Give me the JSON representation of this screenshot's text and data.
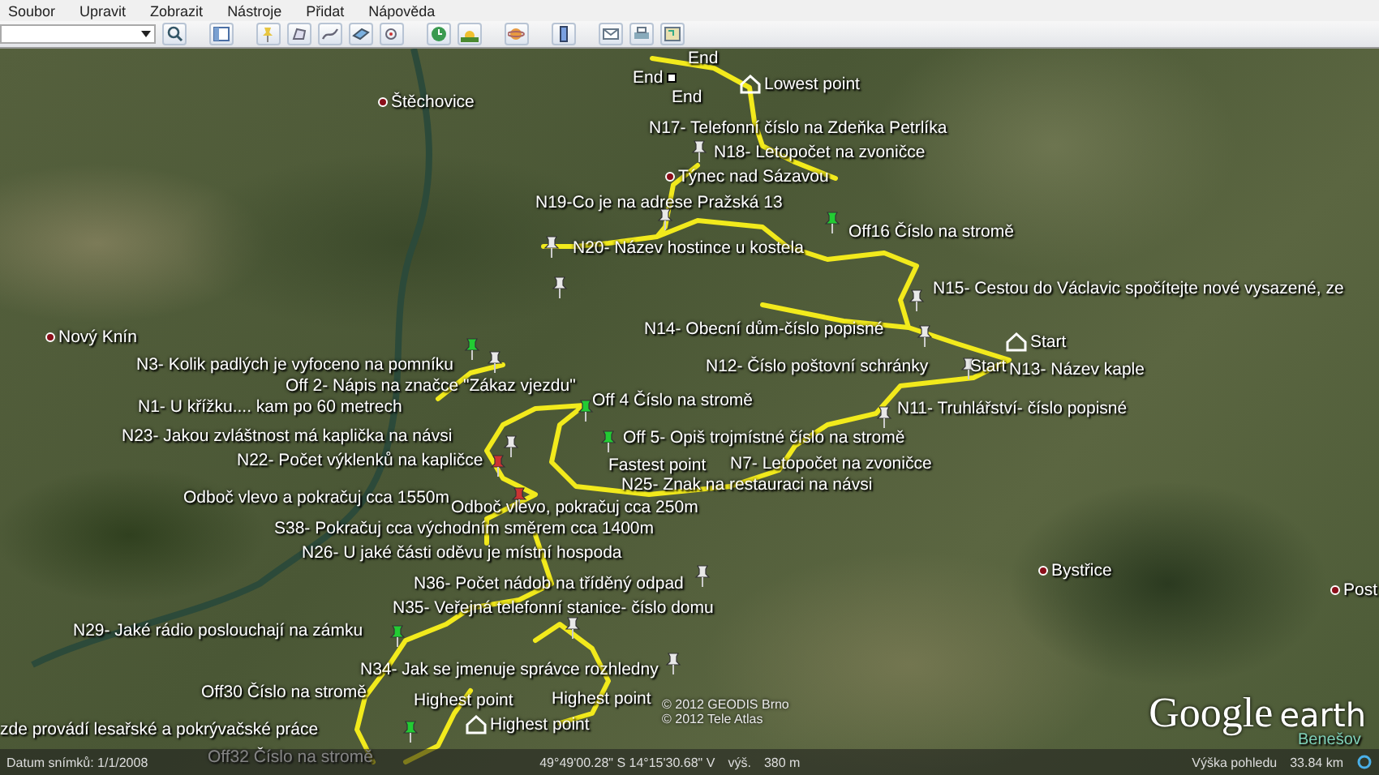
{
  "menu": [
    {
      "label": "Soubor"
    },
    {
      "label": "Upravit"
    },
    {
      "label": "Zobrazit"
    },
    {
      "label": "Nástroje"
    },
    {
      "label": "Přidat"
    },
    {
      "label": "Nápověda"
    }
  ],
  "map": {
    "labels": [
      {
        "kind": "square",
        "text": "End"
      },
      {
        "kind": "label",
        "text": "End"
      },
      {
        "kind": "label",
        "text": "End"
      },
      {
        "kind": "house",
        "text": "Lowest point"
      },
      {
        "kind": "town",
        "text": "Štěchovice"
      },
      {
        "kind": "label",
        "text": "N17- Telefonní číslo na Zdeňka Petrlíka"
      },
      {
        "kind": "label",
        "text": "N18- Letopočet na zvoničce"
      },
      {
        "kind": "town",
        "text": "Týnec nad Sázavou"
      },
      {
        "kind": "label",
        "text": "N19-Co je na adrese Pražská 13"
      },
      {
        "kind": "label",
        "text": "Off16 Číslo na stromě"
      },
      {
        "kind": "label",
        "text": "N20- Název hostince u kostela"
      },
      {
        "kind": "label",
        "text": "N15- Cestou do Václavic spočítejte nové vysazené, ze"
      },
      {
        "kind": "town",
        "text": "Nový Knín"
      },
      {
        "kind": "label",
        "text": "N14- Obecní dům-číslo popisné"
      },
      {
        "kind": "house",
        "text": "Start"
      },
      {
        "kind": "label",
        "text": "N3- Kolik padlých je vyfoceno na pomníku"
      },
      {
        "kind": "label",
        "text": "N12- Číslo poštovní schránky"
      },
      {
        "kind": "label",
        "text": "Start"
      },
      {
        "kind": "label",
        "text": "N13- Název kaple"
      },
      {
        "kind": "label",
        "text": "Off 2- Nápis na značce \"Zákaz vjezdu\""
      },
      {
        "kind": "label",
        "text": "Off 4 Číslo na stromě"
      },
      {
        "kind": "label",
        "text": "N1- U křížku.... kam po 60 metrech"
      },
      {
        "kind": "label",
        "text": "N11- Truhlářství- číslo popisné"
      },
      {
        "kind": "label",
        "text": "N23- Jakou zvláštnost má kaplička na návsi"
      },
      {
        "kind": "label",
        "text": "Off 5- Opiš trojmístné číslo na stromě"
      },
      {
        "kind": "label",
        "text": "N22- Počet výklenků na kapličce"
      },
      {
        "kind": "label",
        "text": "Fastest point"
      },
      {
        "kind": "label",
        "text": "N7- Letopočet na zvoničce"
      },
      {
        "kind": "label",
        "text": "N25- Znak na restauraci na návsi"
      },
      {
        "kind": "label",
        "text": "Odboč vlevo a pokračuj cca 1550m"
      },
      {
        "kind": "label",
        "text": "Odboč vlevo, pokračuj cca 250m"
      },
      {
        "kind": "label",
        "text": "S38- Pokračuj cca východním směrem cca 1400m"
      },
      {
        "kind": "label",
        "text": "N26- U jaké části oděvu je místní hospoda"
      },
      {
        "kind": "town",
        "text": "Bystřice"
      },
      {
        "kind": "label",
        "text": "N36- Počet nádob na tříděný odpad"
      },
      {
        "kind": "town",
        "text": "Post"
      },
      {
        "kind": "label",
        "text": "N35- Veřejná telefonní stanice- číslo domu"
      },
      {
        "kind": "label",
        "text": "N29- Jaké rádio poslouchají na zámku"
      },
      {
        "kind": "label",
        "text": "N34- Jak se jmenuje správce rozhledny"
      },
      {
        "kind": "label",
        "text": "Off30 Číslo na stromě"
      },
      {
        "kind": "label",
        "text": "Highest point"
      },
      {
        "kind": "label",
        "text": "Highest point"
      },
      {
        "kind": "house",
        "text": "Highest point"
      },
      {
        "kind": "label",
        "text": "zde provádí lesařské a pokrývačské práce"
      },
      {
        "kind": "label",
        "text": "Off32 Číslo na stromě"
      },
      {
        "kind": "region",
        "text": "Benešov"
      }
    ],
    "pins": [
      {
        "color": "#e8e8e8"
      },
      {
        "color": "#e8e8e8"
      },
      {
        "color": "#e8e8e8"
      },
      {
        "color": "#22cc33"
      },
      {
        "color": "#e8e8e8"
      },
      {
        "color": "#e8e8e8"
      },
      {
        "color": "#e8e8e8"
      },
      {
        "color": "#e8e8e8"
      },
      {
        "color": "#22cc33"
      },
      {
        "color": "#e8e8e8"
      },
      {
        "color": "#e8e8e8"
      },
      {
        "color": "#22cc33"
      },
      {
        "color": "#22cc33"
      },
      {
        "color": "#cc3333"
      },
      {
        "color": "#cc3333"
      },
      {
        "color": "#e8e8e8"
      },
      {
        "color": "#e8e8e8"
      },
      {
        "color": "#e8e8e8"
      },
      {
        "color": "#22cc33"
      },
      {
        "color": "#e8e8e8"
      },
      {
        "color": "#22cc33"
      }
    ],
    "copyright": [
      "© 2012 GEODIS Brno",
      "© 2012 Tele Atlas"
    ],
    "logo": {
      "brand": "Google",
      "product": "earth"
    }
  },
  "status_bar": {
    "imagery_date": "Datum snímků: 1/1/2008",
    "coordinates": "49°49'00.28\" S  14°15'30.68\" V",
    "elevation_label": "výš.",
    "elevation": "380 m",
    "eye_label": "Výška pohledu",
    "eye_altitude": "33.84 km"
  }
}
